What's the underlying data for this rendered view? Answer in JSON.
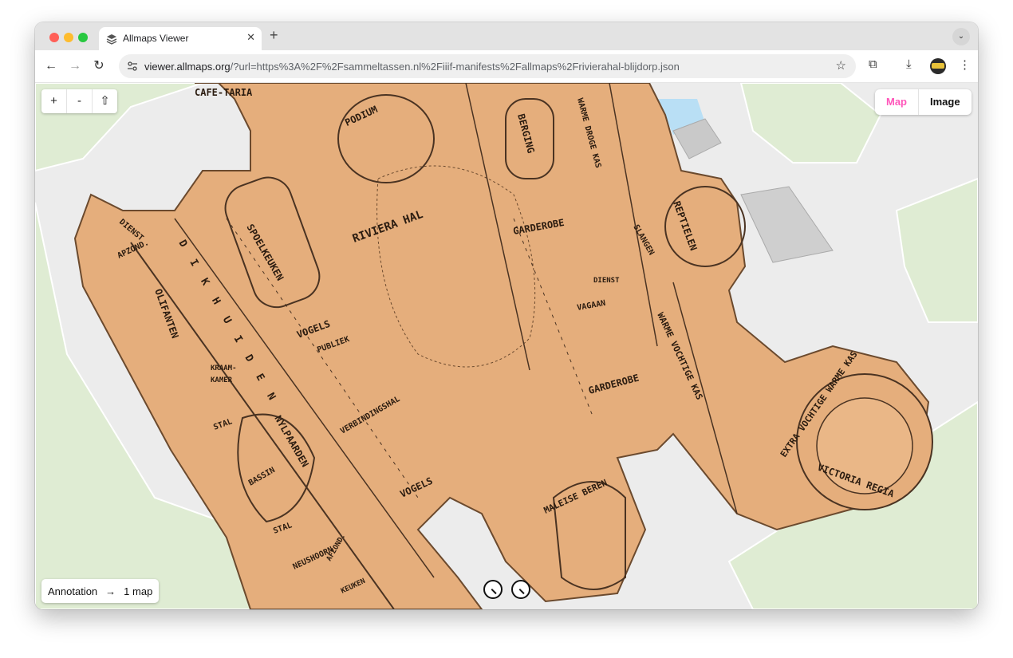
{
  "browser": {
    "tab_title": "Allmaps Viewer",
    "tab_close": "✕",
    "new_tab": "+",
    "tab_menu": "⌄",
    "url_host": "viewer.allmaps.org",
    "url_path": "/?url=https%3A%2F%2Fsammeltassen.nl%2Fiiif-manifests%2Fallmaps%2Frivierahal-blijdorp.json",
    "nav_back": "←",
    "nav_forward": "→",
    "nav_reload": "↻",
    "bookmark": "☆",
    "extensions": "⧉",
    "download": "⤓",
    "menu": "⋮"
  },
  "viewer": {
    "zoom_in": "+",
    "zoom_out": "-",
    "reset_north": "⇧",
    "view_toggle": {
      "map": "Map",
      "image": "Image"
    },
    "annotation": {
      "label": "Annotation",
      "arrow": "→",
      "count": "1 map"
    }
  },
  "colors": {
    "accent": "#ff56ba",
    "map_paper": "#e5ae7c",
    "basemap_bg": "#ececec",
    "basemap_green": "#dfecd3",
    "water": "#b9dff5"
  },
  "map_labels": [
    {
      "text": "CAFE-TARIA"
    },
    {
      "text": "PODIUM"
    },
    {
      "text": "BERGING"
    },
    {
      "text": "WARME DROGE KAS"
    },
    {
      "text": "RIVIERA HAL"
    },
    {
      "text": "GARDEROBE"
    },
    {
      "text": "REPTIELEN"
    },
    {
      "text": "SLANGEN"
    },
    {
      "text": "DIENST"
    },
    {
      "text": "VAGAAN"
    },
    {
      "text": "SPOELKEUKEN"
    },
    {
      "text": "DIENST"
    },
    {
      "text": "APZOND."
    },
    {
      "text": "OLIFANTEN"
    },
    {
      "text": "D I K H U I D E N"
    },
    {
      "text": "VOGELS"
    },
    {
      "text": "PUBLIEK"
    },
    {
      "text": "WARME VOCHTIGE KAS"
    },
    {
      "text": "GARDEROBE"
    },
    {
      "text": "VERBINDINGSHAL"
    },
    {
      "text": "KRAAM-"
    },
    {
      "text": "KAMER"
    },
    {
      "text": "STAL"
    },
    {
      "text": "NYLPAARDEN"
    },
    {
      "text": "BASSIN"
    },
    {
      "text": "VOGELS"
    },
    {
      "text": "MALEISE BEREN"
    },
    {
      "text": "EXTRA VOCHTIGE WARME KAS"
    },
    {
      "text": "VICTORIA REGIA"
    },
    {
      "text": "STAL"
    },
    {
      "text": "NEUSHOORN"
    },
    {
      "text": "AFZOND."
    },
    {
      "text": "KEUKEN"
    }
  ]
}
